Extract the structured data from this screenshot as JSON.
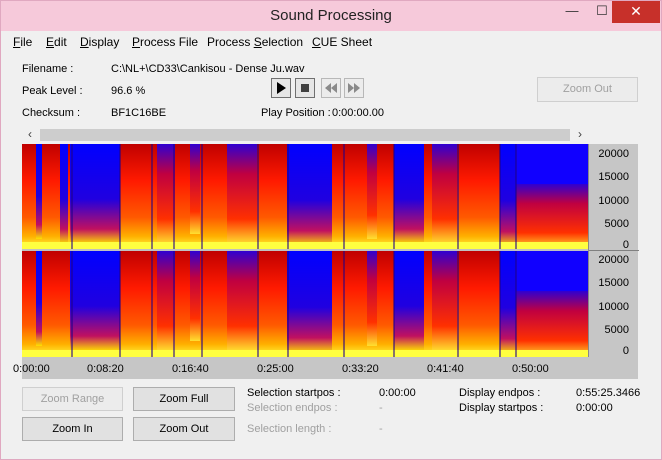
{
  "window": {
    "title": "Sound Processing",
    "minimize_glyph": "—",
    "maximize_glyph": "☐",
    "close_glyph": "✕"
  },
  "menu": [
    {
      "label": "File",
      "underline": "F",
      "rest": "ile"
    },
    {
      "label": "Edit",
      "underline": "E",
      "rest": "dit"
    },
    {
      "label": "Display",
      "underline": "D",
      "rest": "isplay"
    },
    {
      "label": "Process File",
      "underline": "P",
      "rest": "rocess File"
    },
    {
      "label": "Process Selection",
      "pre": "Process ",
      "underline": "S",
      "rest": "election"
    },
    {
      "label": "CUE Sheet",
      "underline": "C",
      "rest": "UE Sheet"
    }
  ],
  "info": {
    "filename_label": "Filename :",
    "filename_value": "C:\\NL+\\CD33\\Cankisou - Dense Ju.wav",
    "peak_label": "Peak Level :",
    "peak_value": "96.6 %",
    "checksum_label": "Checksum :",
    "checksum_value": "BF1C16BE",
    "playpos_label": "Play Position :",
    "playpos_value": "0:00:00.00"
  },
  "transport": {
    "icons": [
      "play-icon",
      "stop-icon",
      "rewind-icon",
      "fast-forward-icon"
    ]
  },
  "buttons": {
    "zoom_out_top": "Zoom Out",
    "zoom_range": "Zoom Range",
    "zoom_full": "Zoom Full",
    "zoom_in": "Zoom In",
    "zoom_out": "Zoom Out"
  },
  "scroll": {
    "left_glyph": "‹",
    "right_glyph": "›"
  },
  "spectrogram": {
    "y_labels": [
      "20000",
      "15000",
      "10000",
      "5000",
      "0"
    ],
    "x_labels": [
      "0:00:00",
      "0:08:20",
      "0:16:40",
      "0:25:00",
      "0:33:20",
      "0:41:40",
      "0:50:00"
    ],
    "channels": 2,
    "colors": {
      "low": "#0000ff",
      "mid": "#ff0000",
      "high": "#ffff00"
    }
  },
  "selection": {
    "startpos_label": "Selection startpos :",
    "startpos_value": "0:00:00",
    "endpos_label": "Selection endpos :",
    "endpos_value": "-",
    "length_label": "Selection length :",
    "length_value": "-",
    "display_endpos_label": "Display endpos :",
    "display_endpos_value": "0:55:25.3466",
    "display_startpos_label": "Display startpos :",
    "display_startpos_value": "0:00:00"
  }
}
